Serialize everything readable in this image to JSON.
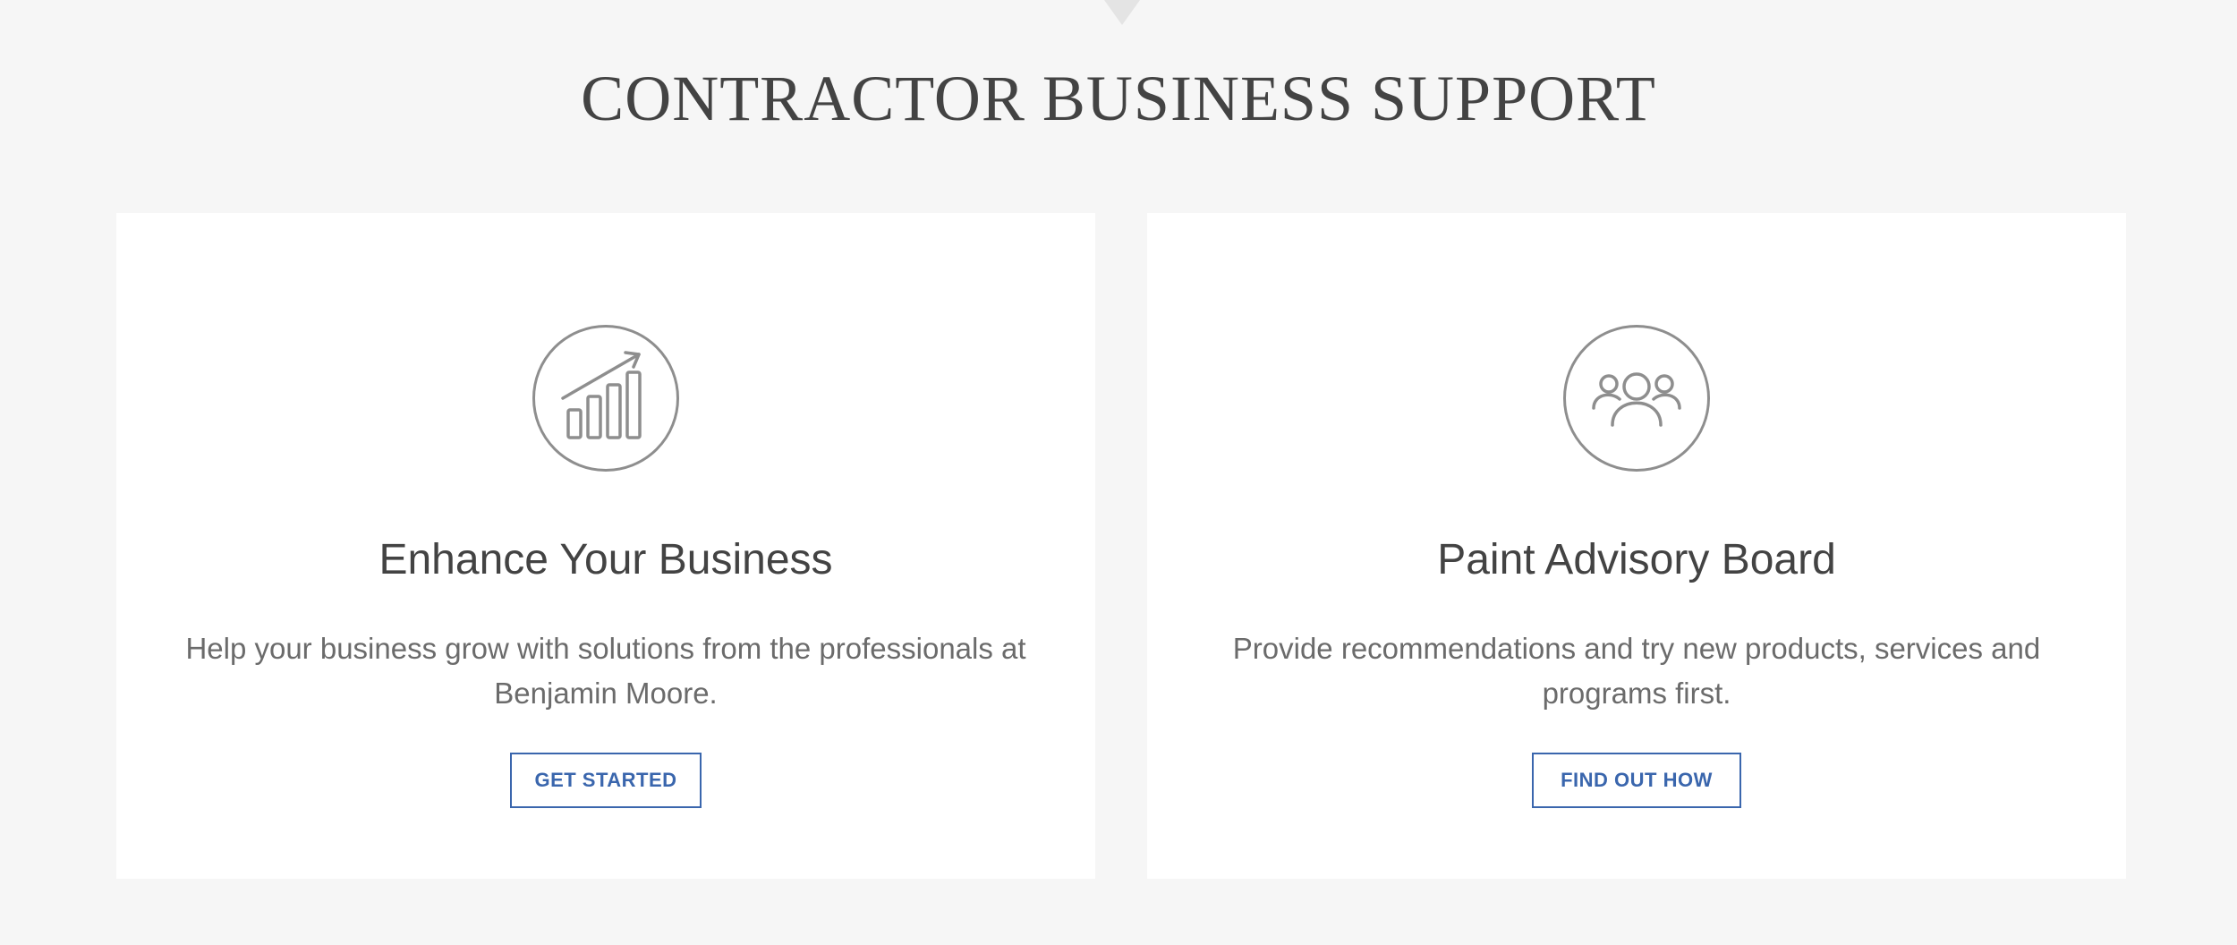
{
  "section": {
    "title": "CONTRACTOR BUSINESS SUPPORT"
  },
  "cards": [
    {
      "icon": "growth-chart-icon",
      "title": "Enhance Your Business",
      "description": "Help your business grow with solutions from the professionals at Benjamin Moore.",
      "button_label": "GET STARTED"
    },
    {
      "icon": "group-people-icon",
      "title": "Paint Advisory Board",
      "description": "Provide recommendations and try new products, services and programs first.",
      "button_label": "FIND OUT HOW"
    }
  ],
  "colors": {
    "background": "#f6f6f6",
    "card": "#ffffff",
    "heading": "#434343",
    "body_text": "#6b6b6b",
    "accent": "#3a66ad",
    "icon": "#8e8e8e"
  }
}
